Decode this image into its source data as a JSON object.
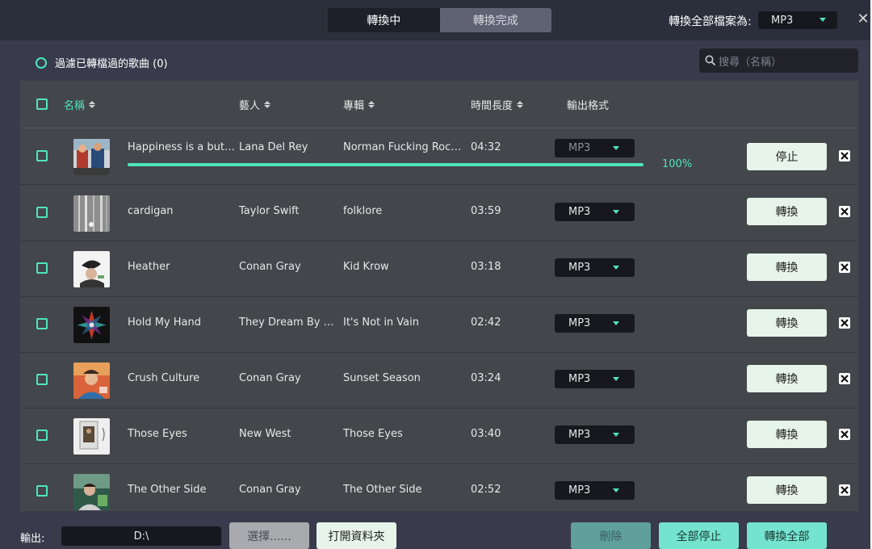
{
  "header": {
    "tabs": [
      {
        "label": "轉換中",
        "active": true
      },
      {
        "label": "轉換完成",
        "active": false
      }
    ],
    "convert_all_label": "轉換全部檔案為:",
    "convert_all_format": "MP3",
    "close_icon": "close-icon"
  },
  "toolbar": {
    "filter_label": "過濾已轉檔過的歌曲 (0)",
    "search_placeholder": "搜尋（名稱）"
  },
  "table": {
    "columns": {
      "name": "名稱",
      "artist": "藝人",
      "album": "專輯",
      "duration": "時間長度",
      "format": "輸出格式"
    },
    "rows": [
      {
        "title": "Happiness is a butterfly",
        "artist": "Lana Del Rey",
        "album": "Norman Fucking Rockwell!",
        "duration": "04:32",
        "format": "MP3",
        "action": "停止",
        "progress_label": "100%",
        "progress": 1.0,
        "converting": true
      },
      {
        "title": "cardigan",
        "artist": "Taylor Swift",
        "album": "folklore",
        "duration": "03:59",
        "format": "MP3",
        "action": "轉換"
      },
      {
        "title": "Heather",
        "artist": "Conan Gray",
        "album": "Kid Krow",
        "duration": "03:18",
        "format": "MP3",
        "action": "轉換"
      },
      {
        "title": "Hold My Hand",
        "artist": "They Dream By Day",
        "album": "It's Not in Vain",
        "duration": "02:42",
        "format": "MP3",
        "action": "轉換"
      },
      {
        "title": "Crush Culture",
        "artist": "Conan Gray",
        "album": "Sunset Season",
        "duration": "03:24",
        "format": "MP3",
        "action": "轉換"
      },
      {
        "title": "Those Eyes",
        "artist": "New West",
        "album": "Those Eyes",
        "duration": "03:40",
        "format": "MP3",
        "action": "轉換"
      },
      {
        "title": "The Other Side",
        "artist": "Conan Gray",
        "album": "The Other Side",
        "duration": "02:52",
        "format": "MP3",
        "action": "轉換"
      }
    ]
  },
  "footer": {
    "output_label": "輸出:",
    "output_path": "D:\\",
    "choose_label": "選擇......",
    "open_folder_label": "打開資料夾",
    "delete_label": "刪除",
    "stop_all_label": "全部停止",
    "convert_all_label": "轉換全部"
  },
  "colors": {
    "accent": "#4fe6bd",
    "background": "#393b4c",
    "table": "#43464a"
  }
}
